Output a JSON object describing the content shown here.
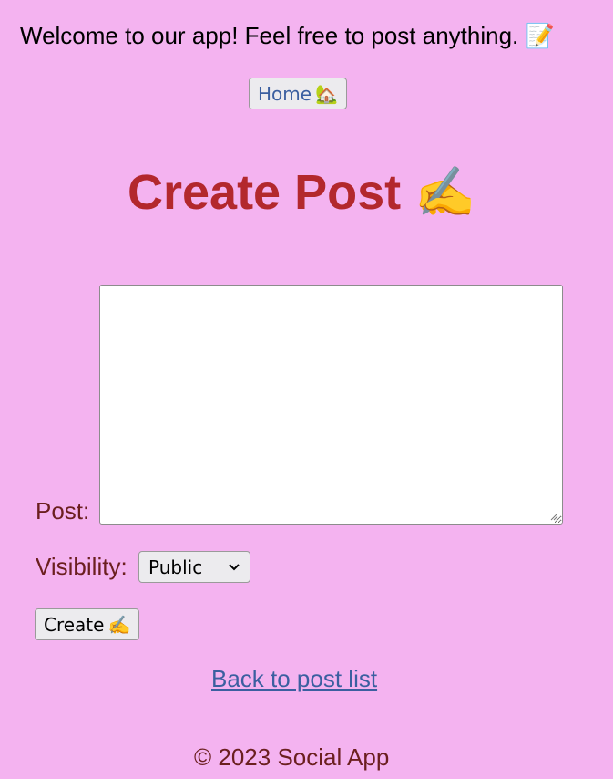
{
  "header": {
    "welcome_text": "Welcome to our app! Feel free to post anything.",
    "welcome_emoji": "📝",
    "home_label": "Home",
    "home_emoji": "🏡"
  },
  "main": {
    "title": "Create Post",
    "title_emoji": "✍️",
    "post_label": "Post:",
    "post_value": "",
    "visibility_label": "Visibility:",
    "visibility_selected": "Public",
    "create_label": "Create",
    "create_emoji": "✍️",
    "back_link": "Back to post list"
  },
  "footer": {
    "text": "© 2023 Social App"
  },
  "colors": {
    "background": "#f4b3f0",
    "title": "#b3282d",
    "link": "#3b5fa0",
    "label": "#6b1f1f"
  },
  "icons": {
    "welcome": "memo-icon",
    "home": "house-icon",
    "title": "writing-hand-icon",
    "create": "writing-hand-icon",
    "select": "chevron-down-icon"
  }
}
